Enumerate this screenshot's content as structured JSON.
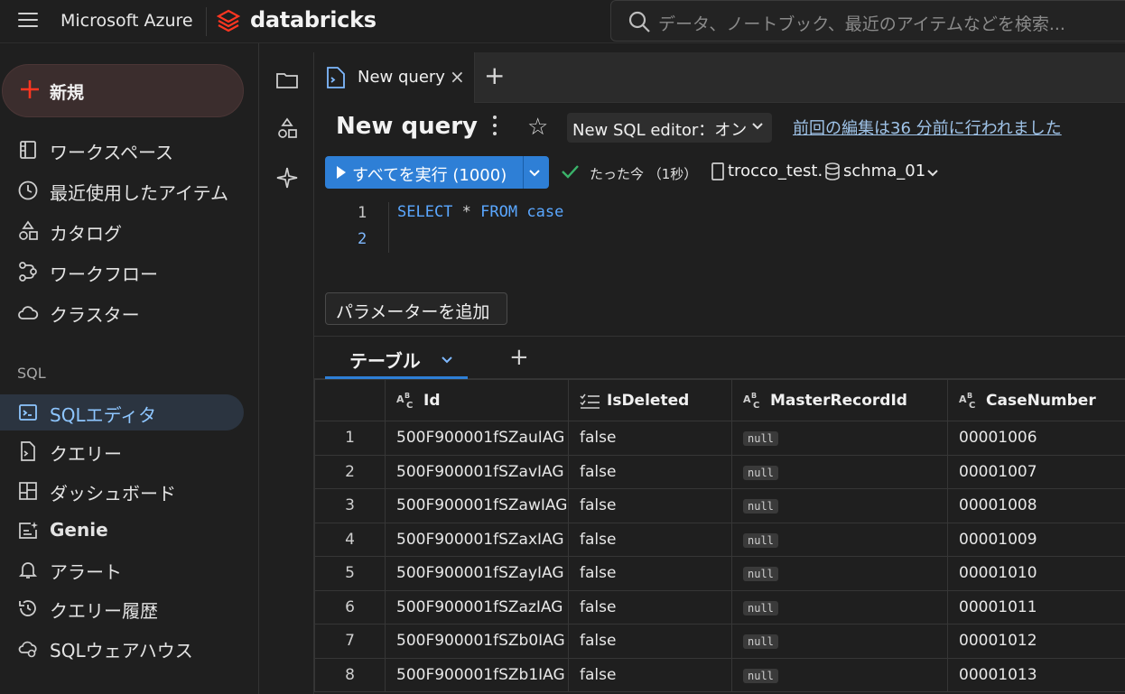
{
  "topbar": {
    "azure": "Microsoft Azure",
    "brand": "databricks",
    "search_placeholder": "データ、ノートブック、最近のアイテムなどを検索..."
  },
  "sidebar": {
    "new_label": "新規",
    "items": [
      {
        "label": "ワークスペース",
        "icon": "workspace-icon"
      },
      {
        "label": "最近使用したアイテム",
        "icon": "clock-icon"
      },
      {
        "label": "カタログ",
        "icon": "catalog-icon"
      },
      {
        "label": "ワークフロー",
        "icon": "workflow-icon"
      },
      {
        "label": "クラスター",
        "icon": "cloud-icon"
      }
    ],
    "sql_section": "SQL",
    "sql_items": [
      {
        "label": "SQLエディタ",
        "icon": "sql-editor-icon",
        "active": true
      },
      {
        "label": "クエリー",
        "icon": "query-icon"
      },
      {
        "label": "ダッシュボード",
        "icon": "dashboard-icon"
      },
      {
        "label": "Genie",
        "icon": "genie-icon"
      },
      {
        "label": "アラート",
        "icon": "bell-icon"
      },
      {
        "label": "クエリー履歴",
        "icon": "history-icon"
      },
      {
        "label": "SQLウェアハウス",
        "icon": "warehouse-icon"
      }
    ]
  },
  "tabs": {
    "active": "New query",
    "close": "×",
    "add": "+"
  },
  "query": {
    "title": "New query",
    "editor_toggle": "New SQL editor：オン",
    "last_edit": "前回の編集は36 分前に行われました",
    "run_label": "すべてを実行 (1000)",
    "run_status": "たった今 （1秒）",
    "catalog": "trocco_test.",
    "schema": "schma_01",
    "code": {
      "line1_no": "1",
      "line2_no": "2",
      "select": "SELECT",
      "star": "*",
      "from": "FROM",
      "table": "case"
    },
    "add_param": "パラメーターを追加"
  },
  "results": {
    "tab_label": "テーブル",
    "add": "+",
    "columns": [
      "Id",
      "IsDeleted",
      "MasterRecordId",
      "CaseNumber"
    ],
    "column_types": [
      "string",
      "boolean",
      "string",
      "string"
    ],
    "null_label": "null",
    "rows": [
      {
        "n": "1",
        "id": "500F900001fSZauIAG",
        "deleted": "false",
        "master": "null",
        "case": "00001006"
      },
      {
        "n": "2",
        "id": "500F900001fSZavIAG",
        "deleted": "false",
        "master": "null",
        "case": "00001007"
      },
      {
        "n": "3",
        "id": "500F900001fSZawIAG",
        "deleted": "false",
        "master": "null",
        "case": "00001008"
      },
      {
        "n": "4",
        "id": "500F900001fSZaxIAG",
        "deleted": "false",
        "master": "null",
        "case": "00001009"
      },
      {
        "n": "5",
        "id": "500F900001fSZayIAG",
        "deleted": "false",
        "master": "null",
        "case": "00001010"
      },
      {
        "n": "6",
        "id": "500F900001fSZazIAG",
        "deleted": "false",
        "master": "null",
        "case": "00001011"
      },
      {
        "n": "7",
        "id": "500F900001fSZb0IAG",
        "deleted": "false",
        "master": "null",
        "case": "00001012"
      },
      {
        "n": "8",
        "id": "500F900001fSZb1IAG",
        "deleted": "false",
        "master": "null",
        "case": "00001013"
      }
    ]
  },
  "colors": {
    "accent": "#2e7fd6",
    "brand_red": "#ff3621",
    "success": "#3ab36a",
    "active_nav": "#8ec6ff"
  }
}
